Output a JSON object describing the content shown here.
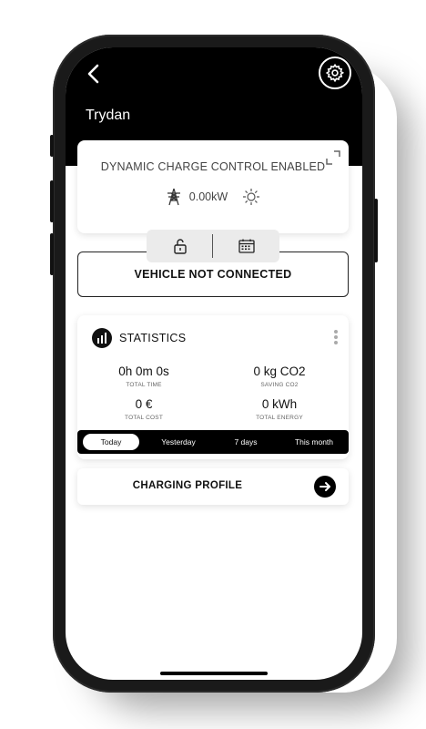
{
  "header": {
    "title": "Trydan",
    "back_icon": "chevron-left-icon",
    "settings_icon": "gear-icon"
  },
  "dynamic_control": {
    "text": "DYNAMIC CHARGE CONTROL ENABLED",
    "power": "0.00kW",
    "icons": [
      "expand-icon",
      "power-tower-icon",
      "sun-icon"
    ]
  },
  "action_tabs": [
    "unlock-icon",
    "calendar-icon"
  ],
  "vehicle_status": "VEHICLE NOT CONNECTED",
  "statistics": {
    "title": "STATISTICS",
    "total_time": {
      "value": "0h 0m 0s",
      "label": "TOTAL TIME"
    },
    "saving_co2": {
      "value": "0 kg CO2",
      "label": "SAVING CO2"
    },
    "total_cost": {
      "value": "0 €",
      "label": "TOTAL COST"
    },
    "total_energy": {
      "value": "0 kWh",
      "label": "TOTAL ENERGY"
    }
  },
  "periods": {
    "today": "Today",
    "yesterday": "Yesterday",
    "week": "7 days",
    "month": "This month",
    "selected": "Today"
  },
  "charging_profile": {
    "label": "CHARGING PROFILE",
    "icon": "arrow-right-icon"
  },
  "colors": {
    "background": "#000000",
    "card": "#ffffff",
    "accent": "#000000"
  }
}
